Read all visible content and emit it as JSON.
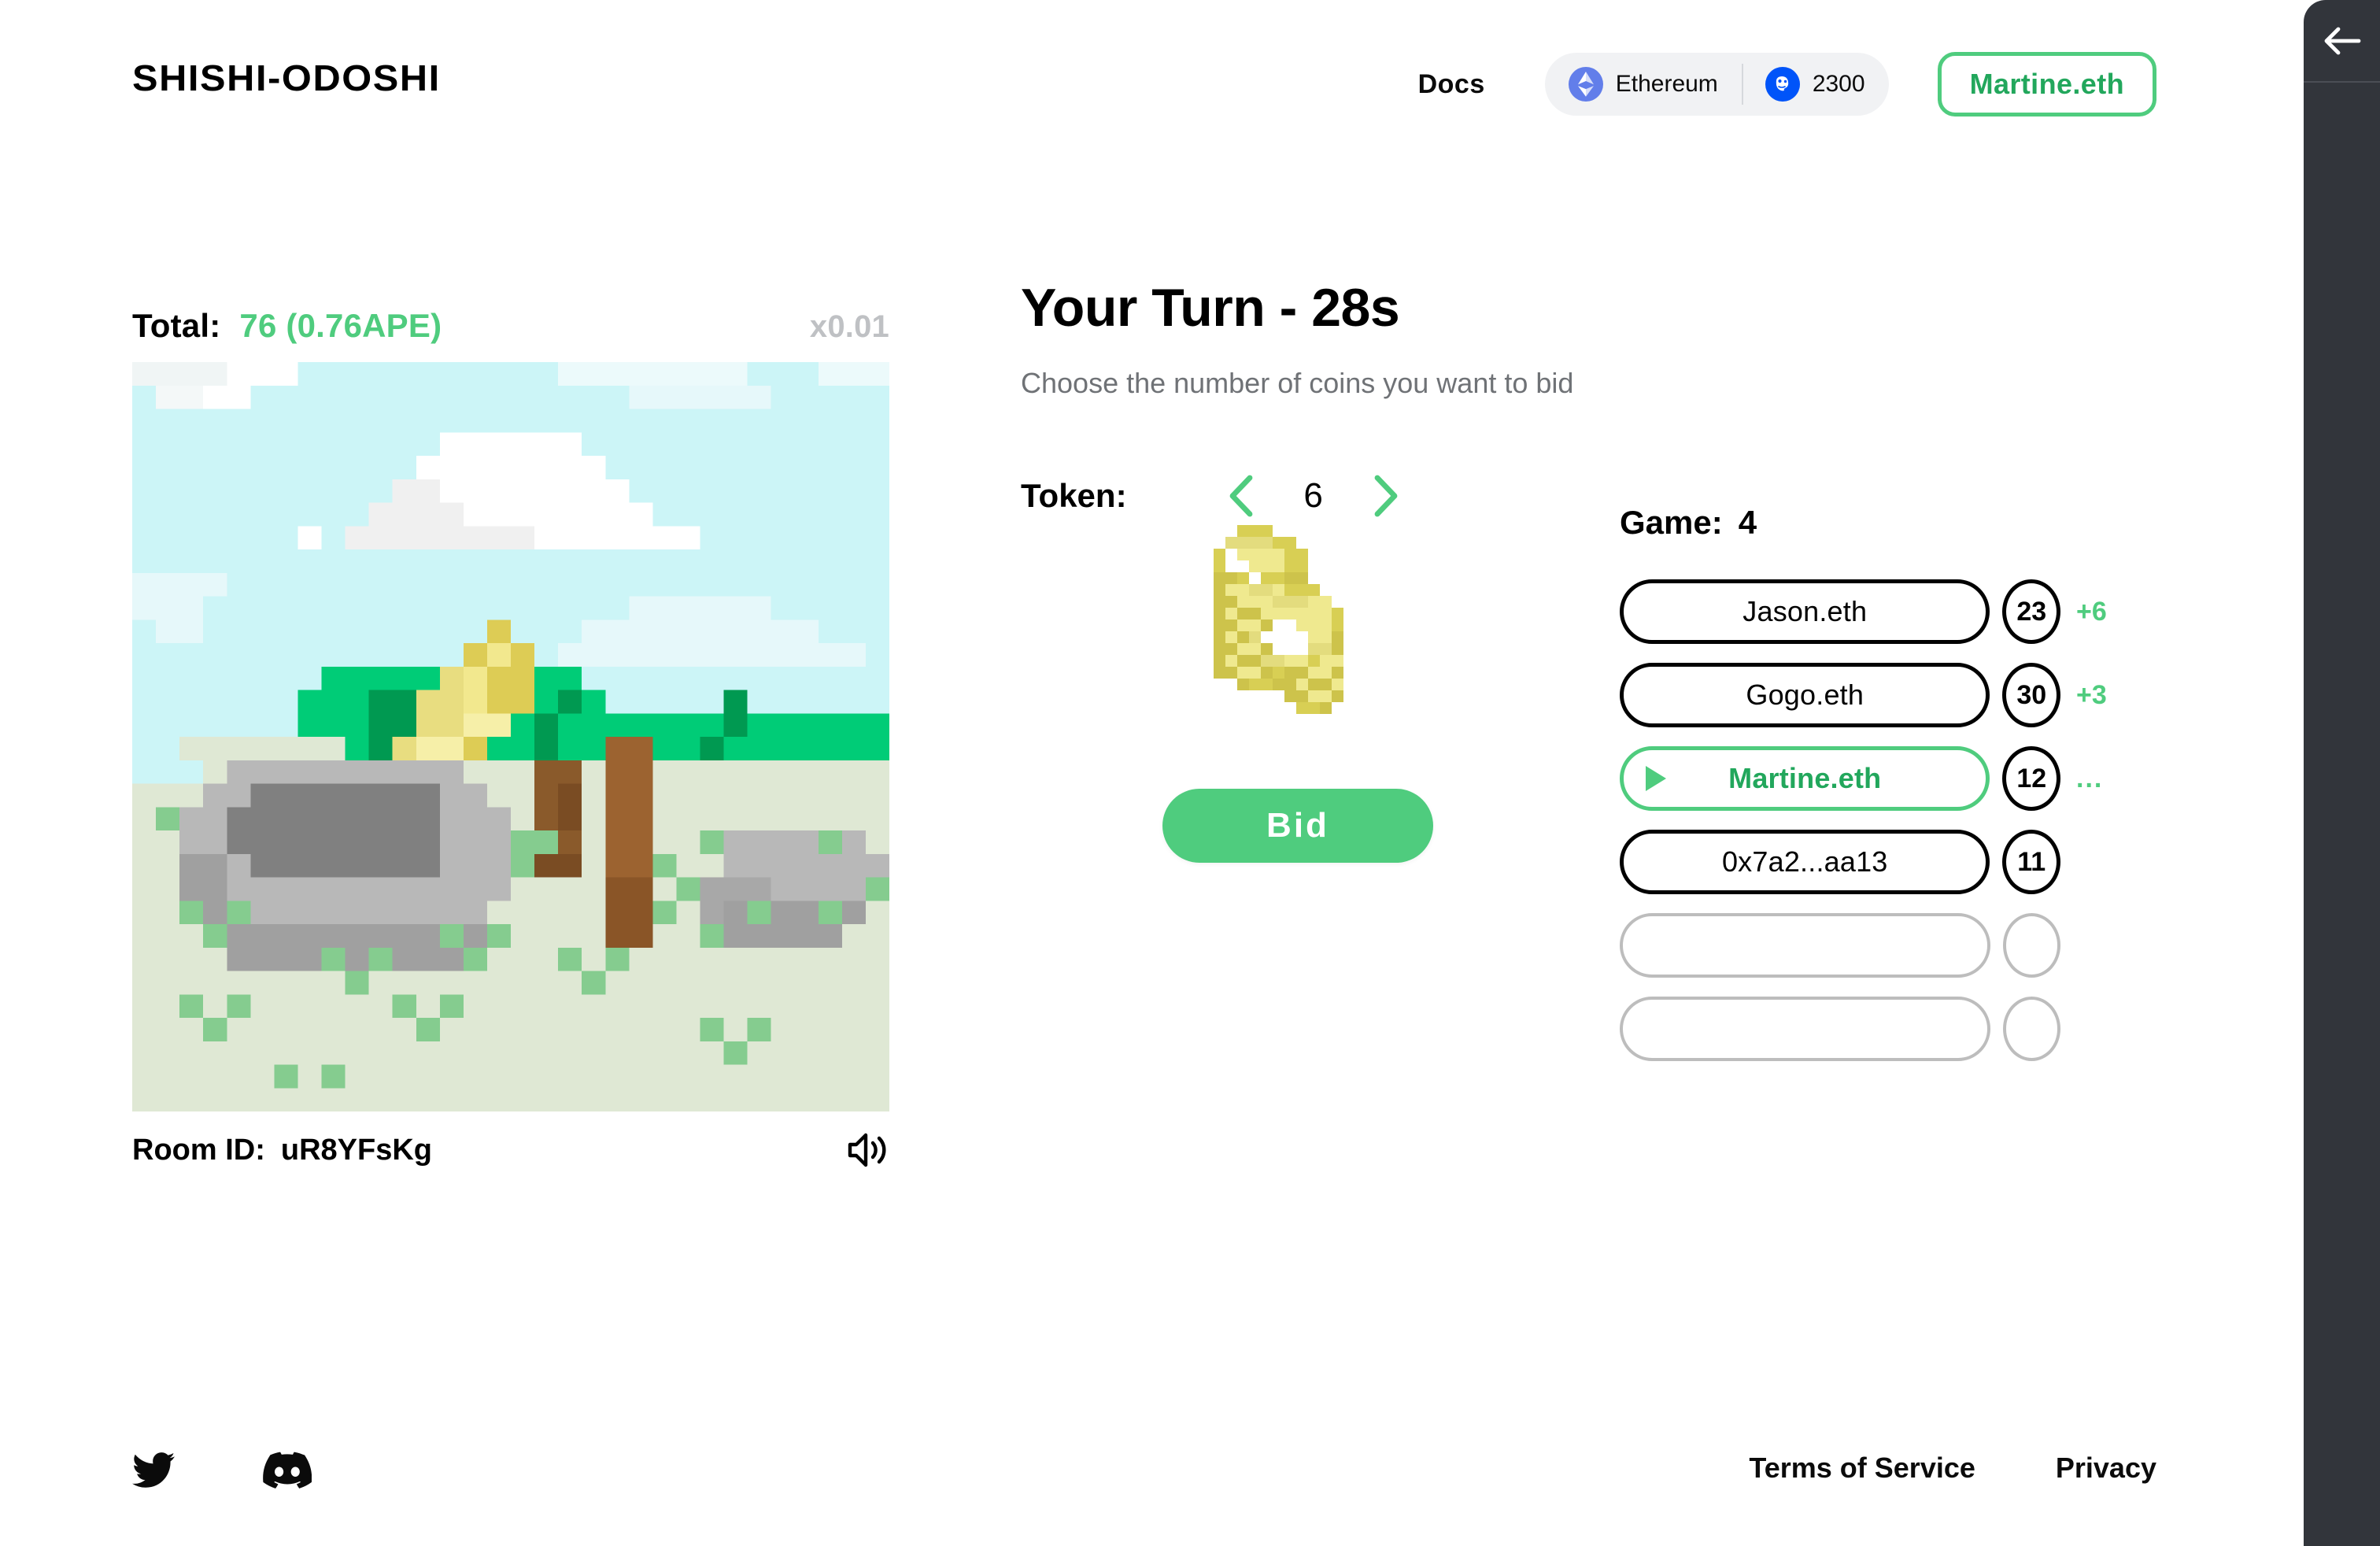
{
  "header": {
    "brand": "SHISHI-ODOSHI",
    "docs_label": "Docs",
    "network_chip": {
      "icon": "ethereum-icon",
      "label": "Ethereum"
    },
    "balance_chip": {
      "icon": "ape-coin-icon",
      "label": "2300"
    },
    "wallet_label": "Martine.eth"
  },
  "left": {
    "total_label": "Total:",
    "total_value": "76 (0.76APE)",
    "multiplier": "x0.01",
    "room_label": "Room ID:",
    "room_value": "uR8YFsKg",
    "sound_icon": "speaker-icon"
  },
  "center": {
    "turn_title": "Your Turn - 28s",
    "turn_subtitle": "Choose the number of coins you want to bid",
    "token_label": "Token:",
    "token_value": "6",
    "prev_icon": "chevron-left-icon",
    "next_icon": "chevron-right-icon",
    "coins_icon": "pixel-coins-icon",
    "bid_label": "Bid"
  },
  "players": {
    "game_label": "Game:",
    "game_value": "4",
    "rows": [
      {
        "name": "Jason.eth",
        "score": "23",
        "delta": "+6",
        "active": false,
        "empty": false
      },
      {
        "name": "Gogo.eth",
        "score": "30",
        "delta": "+3",
        "active": false,
        "empty": false
      },
      {
        "name": "Martine.eth",
        "score": "12",
        "delta": "...",
        "active": true,
        "empty": false
      },
      {
        "name": "0x7a2...aa13",
        "score": "11",
        "delta": "",
        "active": false,
        "empty": false
      },
      {
        "name": "",
        "score": "",
        "delta": "",
        "active": false,
        "empty": true
      },
      {
        "name": "",
        "score": "",
        "delta": "",
        "active": false,
        "empty": true
      }
    ]
  },
  "footer": {
    "twitter_icon": "twitter-icon",
    "discord_icon": "discord-icon",
    "terms_label": "Terms of Service",
    "privacy_label": "Privacy"
  },
  "drawer": {
    "back_icon": "arrow-left-icon"
  },
  "colors": {
    "accent_green": "#4fcc7e",
    "accent_green_text": "#22a75c",
    "muted": "#bfc1c4",
    "drawer_bg": "#32353b",
    "eth_blue": "#627eea",
    "ape_blue": "#0054f9"
  }
}
